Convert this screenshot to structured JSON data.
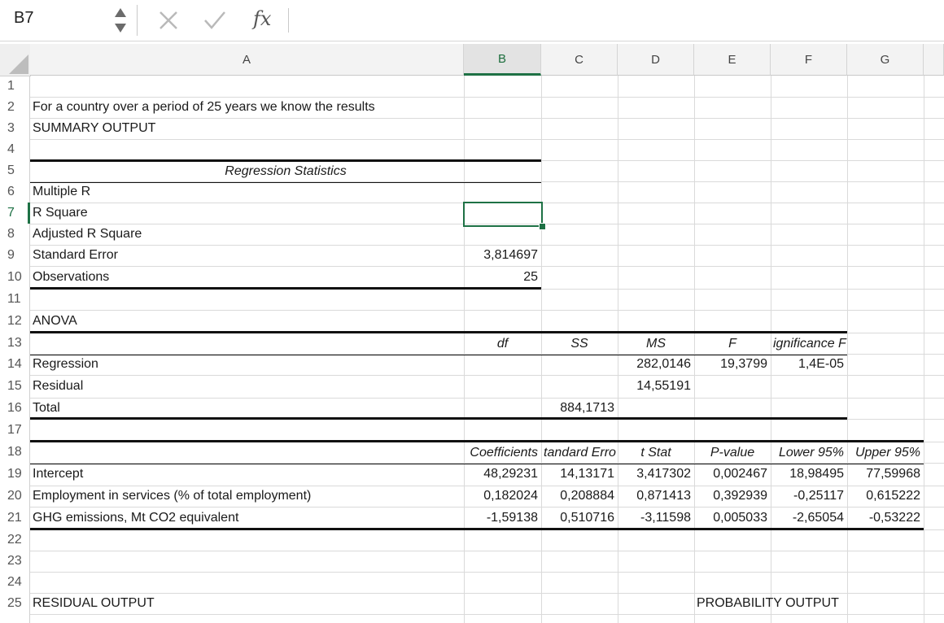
{
  "formula_bar": {
    "name_box": "B7",
    "formula": "",
    "fx_label": "fx"
  },
  "columns": [
    "A",
    "B",
    "C",
    "D",
    "E",
    "F",
    "G"
  ],
  "selected_column": "B",
  "rows": [
    "1",
    "2",
    "3",
    "4",
    "5",
    "6",
    "7",
    "8",
    "9",
    "10",
    "11",
    "12",
    "13",
    "14",
    "15",
    "16",
    "17",
    "18",
    "19",
    "20",
    "21",
    "22",
    "23",
    "24",
    "25"
  ],
  "selected_row": "7",
  "sheet": {
    "intro": "For a country over a period of 25 years we know the results",
    "summary_title": "SUMMARY OUTPUT",
    "regression_statistics": {
      "header": "Regression Statistics",
      "labels": [
        "Multiple R",
        "R Square",
        "Adjusted R Square",
        "Standard Error",
        "Observations"
      ],
      "values": [
        "",
        "",
        "",
        "3,814697",
        "25"
      ]
    },
    "anova": {
      "title": "ANOVA",
      "headers": [
        "df",
        "SS",
        "MS",
        "F",
        "ignificance F"
      ],
      "rows": [
        {
          "label": "Regression",
          "df": "",
          "ss": "",
          "ms": "282,0146",
          "f": "19,3799",
          "sig": "1,4E-05"
        },
        {
          "label": "Residual",
          "df": "",
          "ss": "",
          "ms": "14,55191",
          "f": "",
          "sig": ""
        },
        {
          "label": "Total",
          "df": "",
          "ss": "884,1713",
          "ms": "",
          "f": "",
          "sig": ""
        }
      ]
    },
    "coefficients": {
      "headers": [
        "Coefficients",
        "tandard Erro",
        "t Stat",
        "P-value",
        "Lower 95%",
        "Upper 95%"
      ],
      "rows": [
        {
          "label": "Intercept",
          "values": [
            "48,29231",
            "14,13171",
            "3,417302",
            "0,002467",
            "18,98495",
            "77,59968"
          ]
        },
        {
          "label": "Employment in services (% of total employment)",
          "values": [
            "0,182024",
            "0,208884",
            "0,871413",
            "0,392939",
            "-0,25117",
            "0,615222"
          ]
        },
        {
          "label": "GHG emissions, Mt CO2 equivalent",
          "values": [
            "-1,59138",
            "0,510716",
            "-3,11598",
            "0,005033",
            "-2,65054",
            "-0,53222"
          ]
        }
      ]
    },
    "residual_output": "RESIDUAL OUTPUT",
    "probability_output": "PROBABILITY OUTPUT"
  }
}
